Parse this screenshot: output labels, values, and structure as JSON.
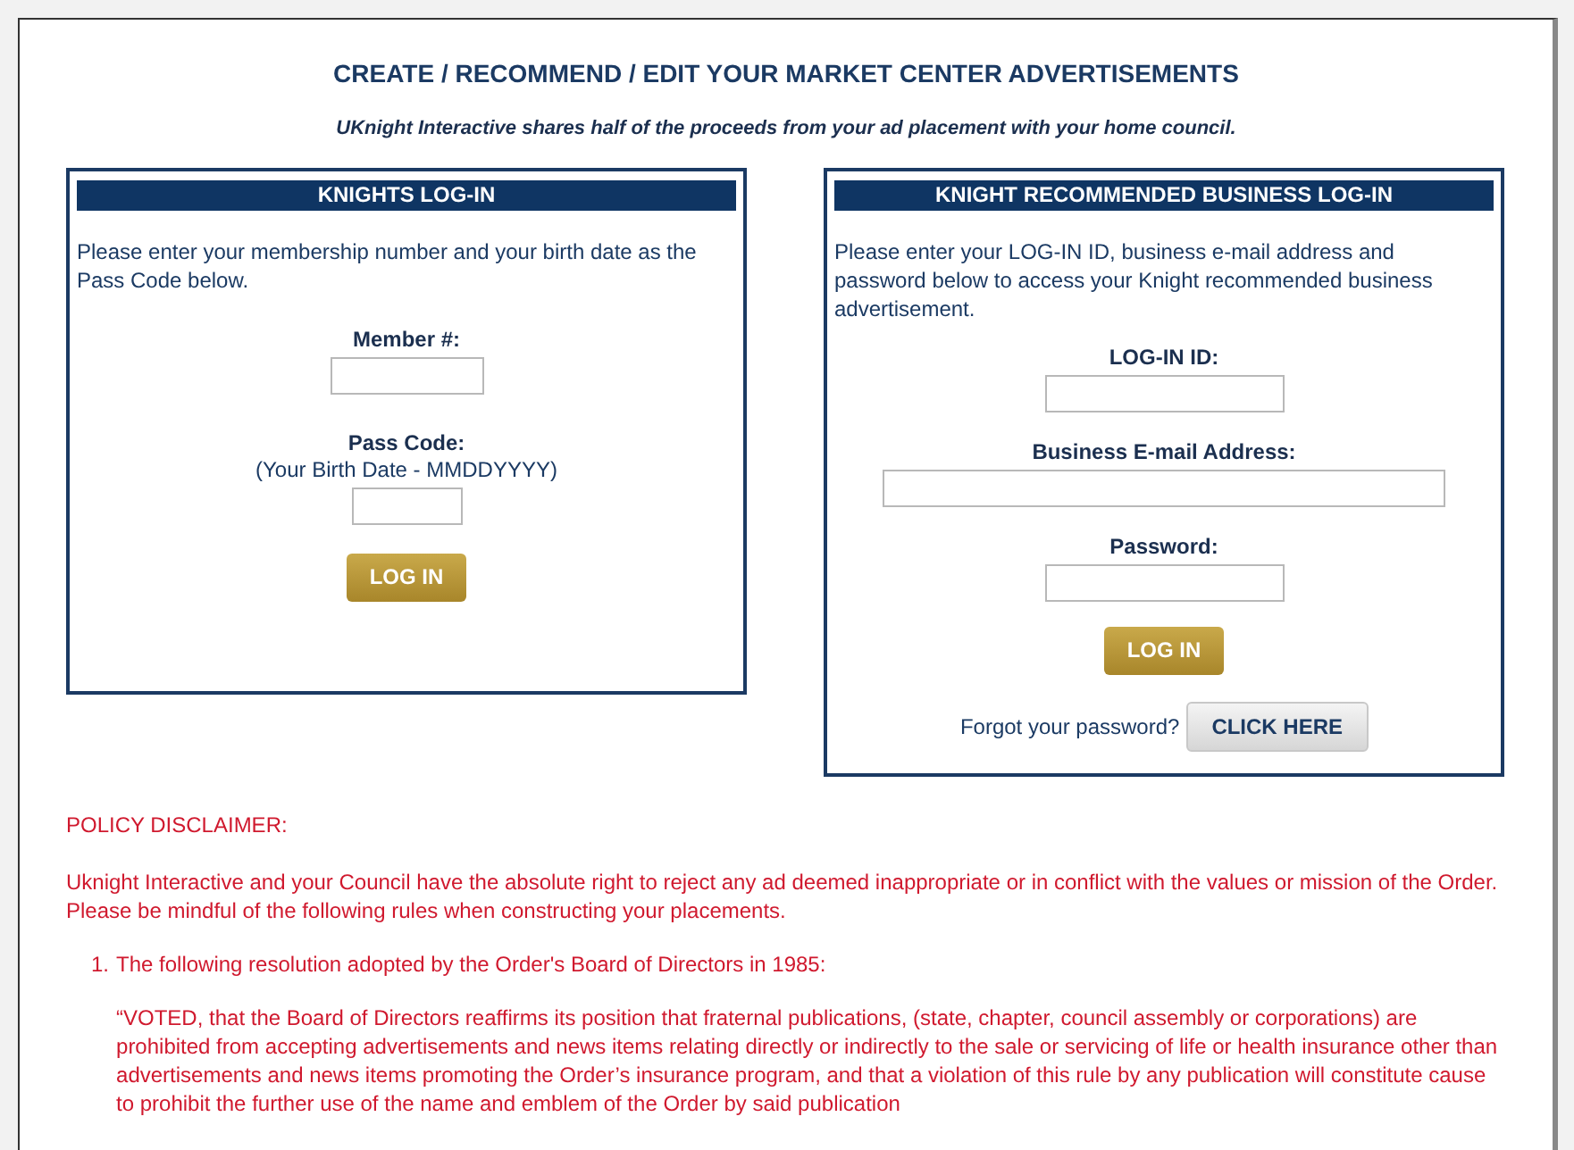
{
  "page": {
    "title": "CREATE / RECOMMEND / EDIT YOUR MARKET CENTER ADVERTISEMENTS",
    "subtitle": "UKnight Interactive shares half of the proceeds from your ad placement with your home council."
  },
  "knights_login": {
    "heading": "KNIGHTS LOG-IN",
    "instructions": "Please enter your membership number and your birth date as the Pass Code below.",
    "fields": [
      {
        "label": "Member #:"
      },
      {
        "label": "Pass Code:",
        "hint": "(Your Birth Date - MMDDYYYY)"
      }
    ],
    "button": "LOG IN"
  },
  "business_login": {
    "heading": "KNIGHT RECOMMENDED BUSINESS LOG-IN",
    "instructions": "Please enter your LOG-IN ID, business e-mail address and password below to access your Knight recommended business advertisement.",
    "fields": [
      {
        "label": "LOG-IN ID:"
      },
      {
        "label": "Business E-mail Address:"
      },
      {
        "label": "Password:"
      }
    ],
    "button": "LOG IN",
    "forgot_text": "Forgot your password?",
    "forgot_button": "CLICK HERE"
  },
  "disclaimer": {
    "heading": "POLICY DISCLAIMER:",
    "intro": "Uknight Interactive and your Council have the absolute right to reject any ad deemed inappropriate or in conflict with the values or mission of the Order. Please be mindful of the following rules when constructing your placements.",
    "rules": [
      {
        "number": "1.",
        "text": "The following resolution adopted by the Order's Board of Directors in 1985:",
        "quote": "“VOTED, that the Board of Directors reaffirms its position that fraternal publications, (state, chapter, council assembly or corporations) are prohibited from accepting advertisements and news items relating directly or indirectly to the sale or servicing of life or health insurance other than advertisements and news items promoting the Order’s insurance program, and that a violation of this rule by any publication will constitute cause to prohibit the further use of the name and emblem of the Order by said publication"
      }
    ]
  }
}
